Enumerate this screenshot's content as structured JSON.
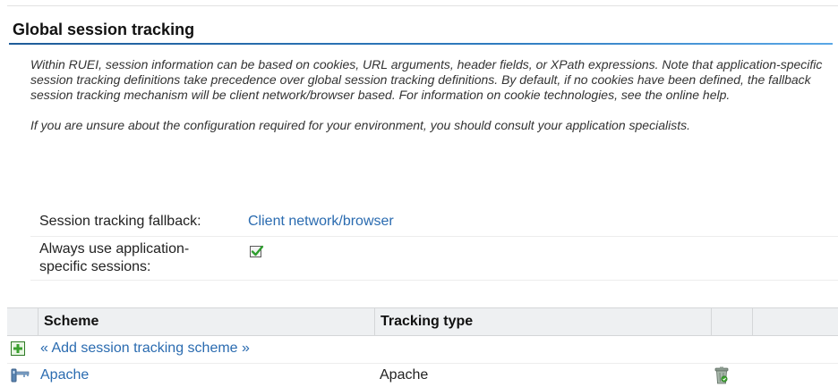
{
  "section": {
    "title": "Global session tracking",
    "description_1": "Within RUEI, session information can be based on cookies, URL arguments, header fields, or XPath expressions. Note that application-specific session tracking definitions take precedence over global session tracking definitions. By default, if no cookies have been defined, the fallback session tracking mechanism will be client network/browser based. For information on cookie technologies, see the online help.",
    "description_2": "If you are unsure about the configuration required for your environment, you should consult your application specialists."
  },
  "settings": {
    "fallback_label": "Session tracking fallback:",
    "fallback_value": "Client network/browser",
    "always_label": "Always use application-specific sessions:",
    "always_checked": true
  },
  "table": {
    "columns": [
      "",
      "Scheme",
      "Tracking type",
      "",
      ""
    ],
    "add_label": "« Add session tracking scheme »",
    "rows": [
      {
        "scheme": "Apache",
        "tracking_type": "Apache"
      }
    ]
  },
  "icons": {
    "add": "add-plus-icon",
    "scheme": "scheme-key-icon",
    "delete": "trash-can-icon",
    "checkbox": "checkmark-icon"
  },
  "colors": {
    "link": "#2a6bb0",
    "underline": "#2f7cc0",
    "check": "#2e9e2e",
    "add_icon": "#3aa02e"
  }
}
